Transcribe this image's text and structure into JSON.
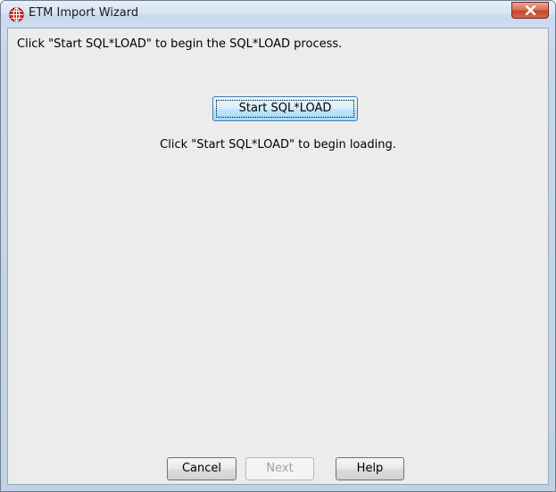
{
  "window": {
    "title": "ETM Import Wizard",
    "app_icon": "globe-icon",
    "close_icon": "close-icon"
  },
  "main": {
    "instruction": "Click \"Start SQL*LOAD\" to begin the SQL*LOAD process.",
    "start_button_label": "Start SQL*LOAD",
    "status_text": "Click \"Start SQL*LOAD\" to begin loading."
  },
  "footer": {
    "cancel_label": "Cancel",
    "next_label": "Next",
    "next_enabled": false,
    "help_label": "Help"
  },
  "colors": {
    "close_button": "#c4462c",
    "app_icon": "#cc1f1f",
    "content_bg": "#ececec"
  }
}
